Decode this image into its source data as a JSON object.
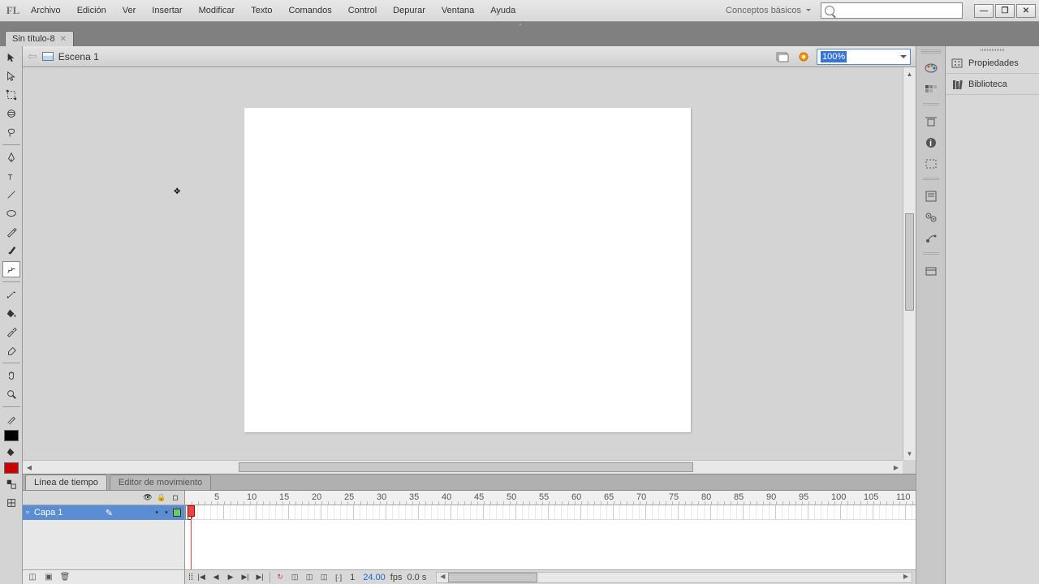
{
  "menu": {
    "items": [
      "Archivo",
      "Edición",
      "Ver",
      "Insertar",
      "Modificar",
      "Texto",
      "Comandos",
      "Control",
      "Depurar",
      "Ventana",
      "Ayuda"
    ],
    "workspace": "Conceptos básicos"
  },
  "document": {
    "tab_name": "Sin título-8",
    "scene": "Escena 1",
    "zoom": "100%"
  },
  "timeline": {
    "tab1": "Línea de tiempo",
    "tab2": "Editor de movimiento",
    "layer1": "Capa 1",
    "ruler_marks": [
      5,
      10,
      15,
      20,
      25,
      30,
      35,
      40,
      45,
      50,
      55,
      60,
      65,
      70,
      75,
      80,
      85,
      90,
      95,
      100,
      105,
      110
    ],
    "frame": "1",
    "fps": "24.00",
    "fps_label": "fps",
    "time": "0.0 s"
  },
  "panels": {
    "properties": "Propiedades",
    "library": "Biblioteca"
  }
}
